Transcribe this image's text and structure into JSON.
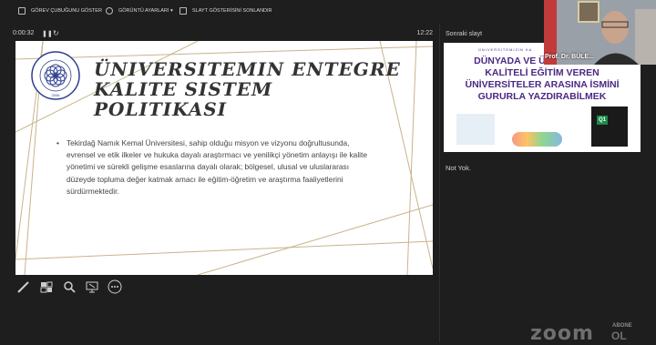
{
  "toolbar": {
    "items": [
      {
        "label": "GÖREV ÇUBUĞUNU GÖSTER",
        "icon": "taskbar-icon"
      },
      {
        "label": "GÖRÜNTÜ AYARLARI ▾",
        "icon": "display-settings-icon"
      },
      {
        "label": "SLAYT GÖSTERİSİNİ SONLANDIR",
        "icon": "end-slideshow-icon"
      }
    ]
  },
  "presenter": {
    "elapsed": "0:00:32",
    "clock": "12:22"
  },
  "slide": {
    "title": "Üniversitemin Entegre Kalite Sistem Politikası",
    "bullet": "Tekirdağ Namık Kemal Üniversitesi, sahip olduğu misyon ve vizyonu doğrultusunda, evrensel ve etik ilkeler ve hukuka dayalı araştırmacı ve yenilikçi yönetim anlayışı ile kalite yönetimi ve sürekli gelişme esaslarına dayalı olarak; bölgesel, ulusal ve uluslararası düzeyde topluma değer katmak amacı ile eğitim-öğretim ve araştırma faaliyetlerini sürdürmektedir.",
    "logo_text": "TEKİRDAĞ NAMIK KEMAL ÜNİVERSİTESİ",
    "logo_year": "2006"
  },
  "next_slide": {
    "label": "Sonraki slayt",
    "top_text": "ÜNİVERSİTEMİZİN KA",
    "title": "DÜNYADA VE ÜLKEMİZDE EN KALİTELİ EĞİTİM VEREN ÜNİVERSİTELER ARASINA İSMİNİ GURURLA YAZDIRABİLMEK",
    "badge": "Q1"
  },
  "notes": {
    "text": "Not Yok."
  },
  "video": {
    "name": "Prof. Dr. BÜLE..."
  },
  "watermark": {
    "zoom": "zoom",
    "abone": "ABONE",
    "ol": "OL"
  },
  "colors": {
    "background": "#1e1e1e",
    "next_title": "#4b2885",
    "slide_lines": "#c8b48c"
  }
}
